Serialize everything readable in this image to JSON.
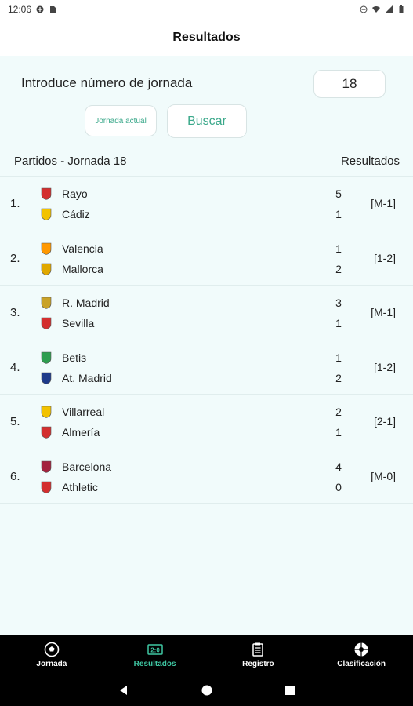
{
  "status_bar": {
    "time": "12:06"
  },
  "app_bar": {
    "title": "Resultados"
  },
  "search": {
    "label": "Introduce número de jornada",
    "jornada_value": "18",
    "btn_actual_label": "Jornada actual",
    "btn_buscar_label": "Buscar"
  },
  "table": {
    "header_left": "Partidos - Jornada 18",
    "header_right": "Resultados"
  },
  "matches": [
    {
      "num": "1.",
      "home": "Rayo",
      "away": "Cádiz",
      "home_score": "5",
      "away_score": "1",
      "code": "[M-1]",
      "home_color": "#d32f2f",
      "away_color": "#f2c200"
    },
    {
      "num": "2.",
      "home": "Valencia",
      "away": "Mallorca",
      "home_score": "1",
      "away_score": "2",
      "code": "[1-2]",
      "home_color": "#ff9800",
      "away_color": "#e0a800"
    },
    {
      "num": "3.",
      "home": "R. Madrid",
      "away": "Sevilla",
      "home_score": "3",
      "away_score": "1",
      "code": "[M-1]",
      "home_color": "#c9a227",
      "away_color": "#d32f2f"
    },
    {
      "num": "4.",
      "home": "Betis",
      "away": "At. Madrid",
      "home_score": "1",
      "away_score": "2",
      "code": "[1-2]",
      "home_color": "#2e9d4f",
      "away_color": "#1e3a8a"
    },
    {
      "num": "5.",
      "home": "Villarreal",
      "away": "Almería",
      "home_score": "2",
      "away_score": "1",
      "code": "[2-1]",
      "home_color": "#f2c200",
      "away_color": "#d32f2f"
    },
    {
      "num": "6.",
      "home": "Barcelona",
      "away": "Athletic",
      "home_score": "4",
      "away_score": "0",
      "code": "[M-0]",
      "home_color": "#a3223e",
      "away_color": "#d32f2f"
    }
  ],
  "bottom_nav": [
    {
      "label": "Jornada",
      "icon": "soccer-ball-icon",
      "active": false
    },
    {
      "label": "Resultados",
      "icon": "scoreboard-icon",
      "active": true
    },
    {
      "label": "Registro",
      "icon": "clipboard-icon",
      "active": false
    },
    {
      "label": "Clasificación",
      "icon": "trophy-ball-icon",
      "active": false
    }
  ],
  "colors": {
    "accent": "#3aa88a",
    "nav_active": "#3fc7a3",
    "background": "#f1fbfb"
  }
}
